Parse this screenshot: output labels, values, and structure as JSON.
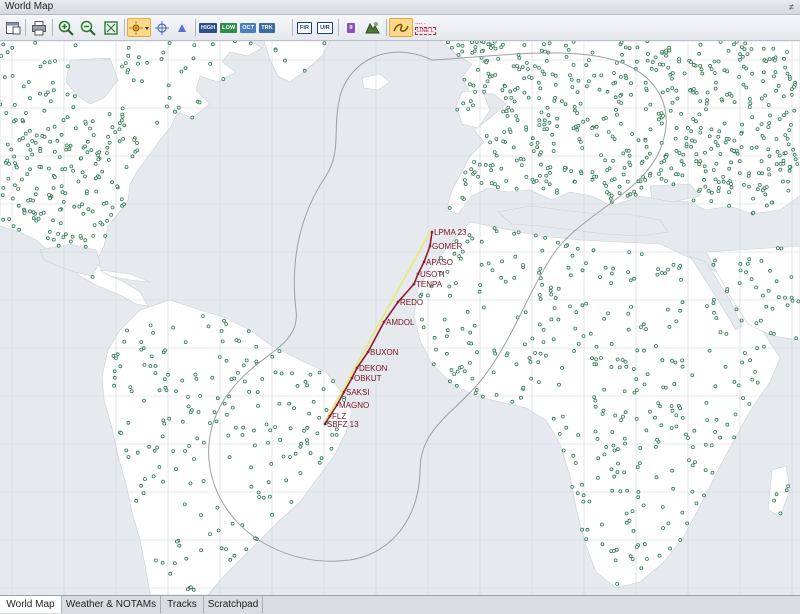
{
  "window": {
    "title": "World Map",
    "pin_glyph": "≠"
  },
  "toolbar": {
    "chips": [
      {
        "label": "HIGH",
        "color": "#2c4f8c"
      },
      {
        "label": "LOW",
        "color": "#2f8f4a"
      },
      {
        "label": "OCT",
        "color": "#4b7fc0"
      },
      {
        "label": "TRK",
        "color": "#3c6c9e"
      }
    ],
    "fir_label": "FIR",
    "uir_label": "UIR",
    "pause_label": "II",
    "legend_lines": [
      "---- -",
      "LINE L"
    ]
  },
  "route": {
    "waypoints": [
      {
        "name": "LPMA 23"
      },
      {
        "name": "GOMER"
      },
      {
        "name": "APASO"
      },
      {
        "name": "USOTI"
      },
      {
        "name": "TENPA"
      },
      {
        "name": "REDO"
      },
      {
        "name": "AMDOL"
      },
      {
        "name": "BUXON"
      },
      {
        "name": "DEKON"
      },
      {
        "name": "OBKUT"
      },
      {
        "name": "SAKSI"
      },
      {
        "name": "MAGNO"
      },
      {
        "name": "FLZ"
      },
      {
        "name": "SBFZ 13"
      }
    ],
    "route_color": "#8e1a2c",
    "alternate_color": "#e6e98a"
  },
  "map_colors": {
    "water": "#e6eaee",
    "land": "#ffffff",
    "grid": "#cfd6de",
    "airport": "#2f7a52",
    "etops": "#9aa0a6"
  },
  "tabs": [
    {
      "label": "World Map",
      "active": true
    },
    {
      "label": "Weather & NOTAMs",
      "active": false
    },
    {
      "label": "Tracks",
      "active": false
    },
    {
      "label": "Scratchpad",
      "active": false
    }
  ]
}
